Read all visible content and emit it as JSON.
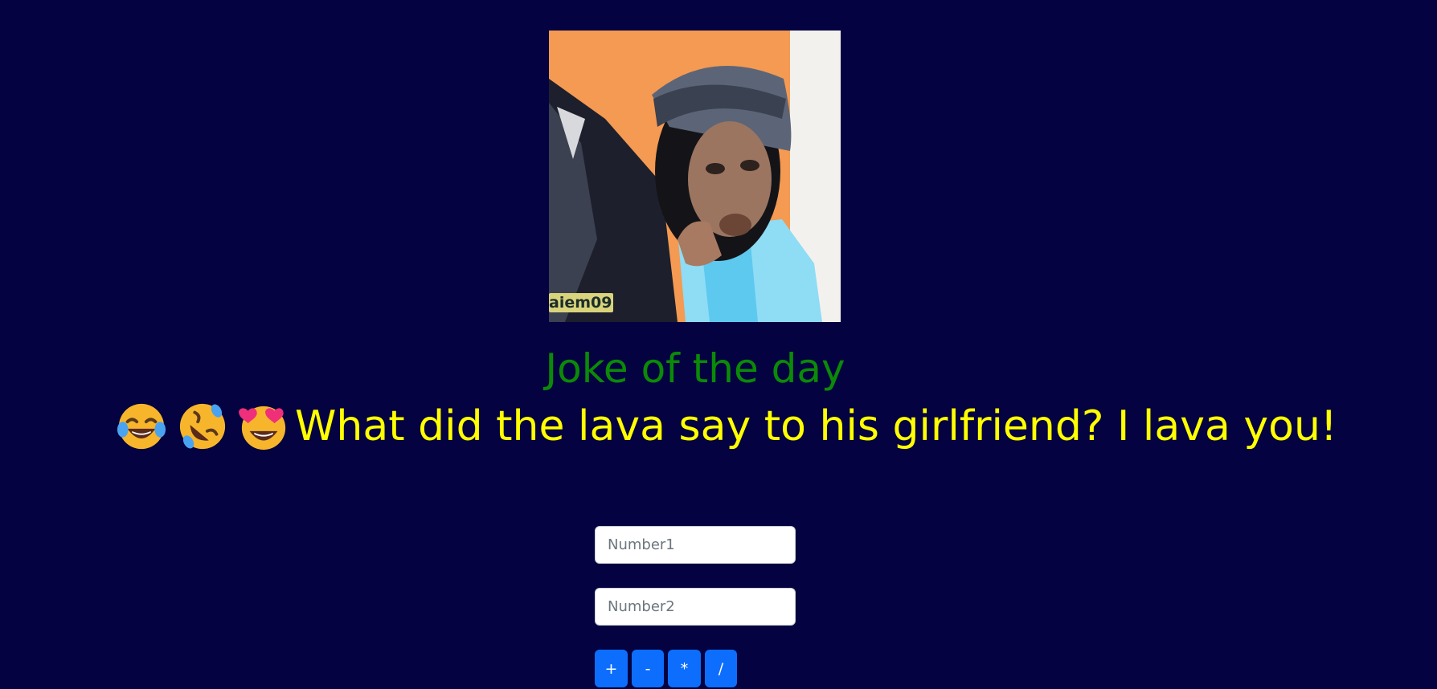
{
  "meme": {
    "watermark": "aiem09"
  },
  "heading": "Joke of the day",
  "joke": {
    "emojis": [
      "face-with-tears-of-joy-icon",
      "rolling-on-the-floor-laughing-icon",
      "smiling-face-with-heart-eyes-icon"
    ],
    "text": "What did the lava say to his girlfriend? I lava you!"
  },
  "calculator": {
    "number1_placeholder": "Number1",
    "number2_placeholder": "Number2",
    "number1_value": "",
    "number2_value": "",
    "buttons": [
      "+",
      "-",
      "*",
      "/"
    ]
  },
  "colors": {
    "background": "#040240",
    "heading": "#0b8a08",
    "joke": "#ffff00",
    "button": "#0d6efd"
  }
}
